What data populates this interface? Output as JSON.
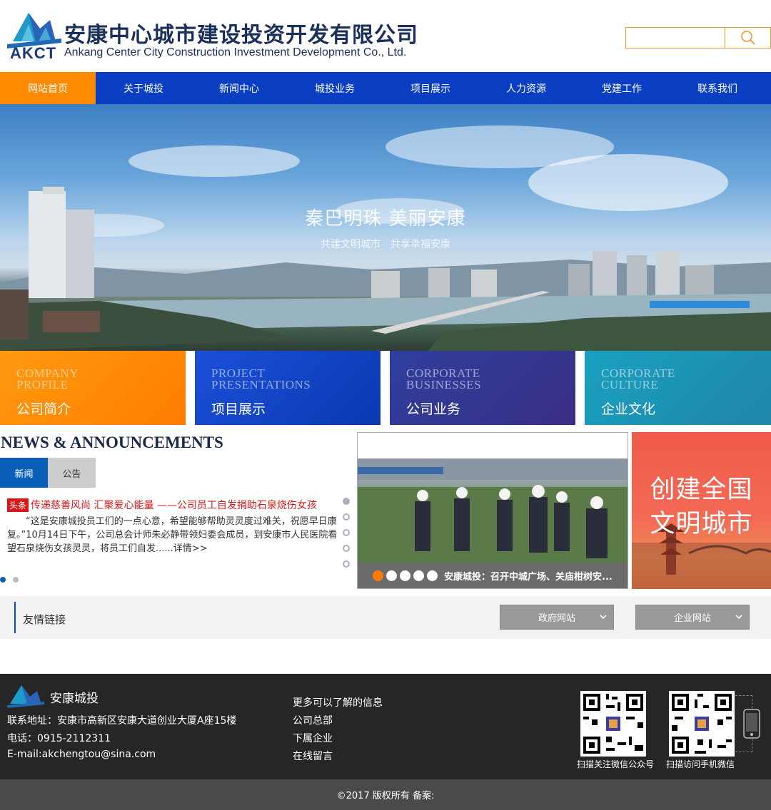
{
  "header": {
    "logo_abbr": "AKCT",
    "company_cn": "安康中心城市建设投资开发有限公司",
    "company_en": "Ankang Center City Construction Investment Development Co., Ltd.",
    "search_placeholder": "",
    "search_icon": "search-icon"
  },
  "nav": {
    "items": [
      "网站首页",
      "关于城投",
      "新闻中心",
      "城投业务",
      "项目展示",
      "人力资源",
      "党建工作",
      "联系我们"
    ],
    "active_index": 0,
    "bg_color": "#0a3fc4",
    "active_color": "#ff8a00"
  },
  "banner": {
    "slogan": "秦巴明珠 美丽安康",
    "sub": "共建文明城市　共享幸福安康"
  },
  "tiles": [
    {
      "en1": "COMPANY",
      "en2": "PROFILE",
      "cn": "公司简介"
    },
    {
      "en1": "PROJECT",
      "en2": "PRESENTATIONS",
      "cn": "项目展示"
    },
    {
      "en1": "CORPORATE",
      "en2": "BUSINESSES",
      "cn": "公司业务"
    },
    {
      "en1": "CORPORATE",
      "en2": "CULTURE",
      "cn": "企业文化"
    }
  ],
  "news": {
    "heading": "NEWS & ANNOUNCEMENTS",
    "tabs": [
      "新闻",
      "公告"
    ],
    "active_tab": 0,
    "headline_tag": "头条",
    "headline": "传递慈善风尚 汇聚爱心能量 ——公司员工自发捐助石泉烧伤女孩",
    "body": "“这是安康城投员工们的一点心意，希望能够帮助灵灵度过难关，祝愿早日康复。”10月14日下午，公司总会计师朱必静带领妇委会成员，到安康市人民医院看望石泉烧伤女孩灵灵，将员工们自发......",
    "more": "详情>>"
  },
  "photo": {
    "caption": "安康城投：召开中城广场、关庙柑树安..."
  },
  "ad": {
    "line1": "创建全国",
    "line2": "文明城市"
  },
  "links": {
    "label": "友情链接",
    "select1": "政府网站",
    "select2": "企业网站"
  },
  "footer": {
    "brand": "安康城投",
    "address": "联系地址：安康市高新区安康大道创业大厦A座15楼",
    "phone": "电话：0915-2112311",
    "email": "E-mail:akchengtou@sina.com",
    "links": [
      "更多可以了解的信息",
      "公司总部",
      "下属企业",
      "在线留言"
    ],
    "qr1_caption": "扫描关注微信公众号",
    "qr2_caption": "扫描访问手机微信",
    "copyright": "©2017 版权所有 备案:"
  }
}
